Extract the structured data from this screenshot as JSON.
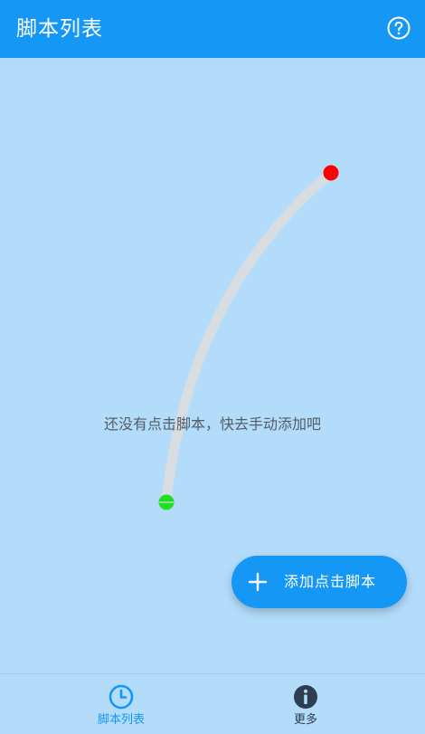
{
  "app_bar": {
    "title": "脚本列表",
    "help_icon": "question-circle-icon"
  },
  "main": {
    "empty_message": "还没有点击脚本，快去手动添加吧"
  },
  "fab": {
    "label": "添加点击脚本",
    "icon": "plus-icon"
  },
  "bottom_nav": {
    "items": [
      {
        "label": "脚本列表",
        "icon": "clock-icon",
        "active": true
      },
      {
        "label": "更多",
        "icon": "info-icon",
        "active": false
      }
    ]
  },
  "colors": {
    "primary": "#1597f5",
    "background": "#b3dcfb",
    "start_point": "#22dd22",
    "end_point": "#ff0000",
    "path": "#d8dde2",
    "active_nav": "#1597f5",
    "inactive_nav": "#2c3e50"
  }
}
